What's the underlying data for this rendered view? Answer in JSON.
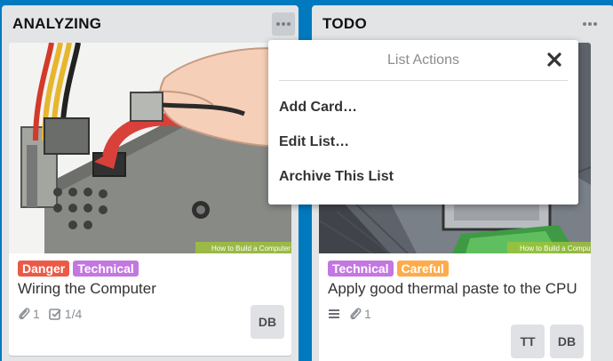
{
  "lists": [
    {
      "title": "ANALYZING",
      "cards": [
        {
          "labels": [
            {
              "text": "Danger",
              "color": "#eb5a46"
            },
            {
              "text": "Technical",
              "color": "#c377e0"
            }
          ],
          "title": "Wiring the Computer",
          "attachments": "1",
          "checklist": "1/4",
          "members": [
            "DB"
          ],
          "watermark": "How to Build a Computer"
        }
      ]
    },
    {
      "title": "TODO",
      "cards": [
        {
          "labels": [
            {
              "text": "Technical",
              "color": "#c377e0"
            },
            {
              "text": "Careful",
              "color": "#ffab4a"
            }
          ],
          "title": "Apply good thermal paste to the CPU",
          "attachments": "1",
          "members": [
            "TT",
            "DB"
          ],
          "watermark": "How to Build a Computer"
        }
      ]
    }
  ],
  "list_actions": {
    "title": "List Actions",
    "items": [
      "Add Card…",
      "Edit List…",
      "Archive This List"
    ]
  },
  "icons": {
    "menu": "ellipsis-icon",
    "close": "close-icon",
    "attachment": "paperclip-icon",
    "checklist": "checkbox-icon",
    "description": "description-icon"
  },
  "colors": {
    "board": "#0079bf",
    "list": "#e2e4e6",
    "danger": "#eb5a46",
    "technical": "#c377e0",
    "careful": "#ffab4a"
  }
}
